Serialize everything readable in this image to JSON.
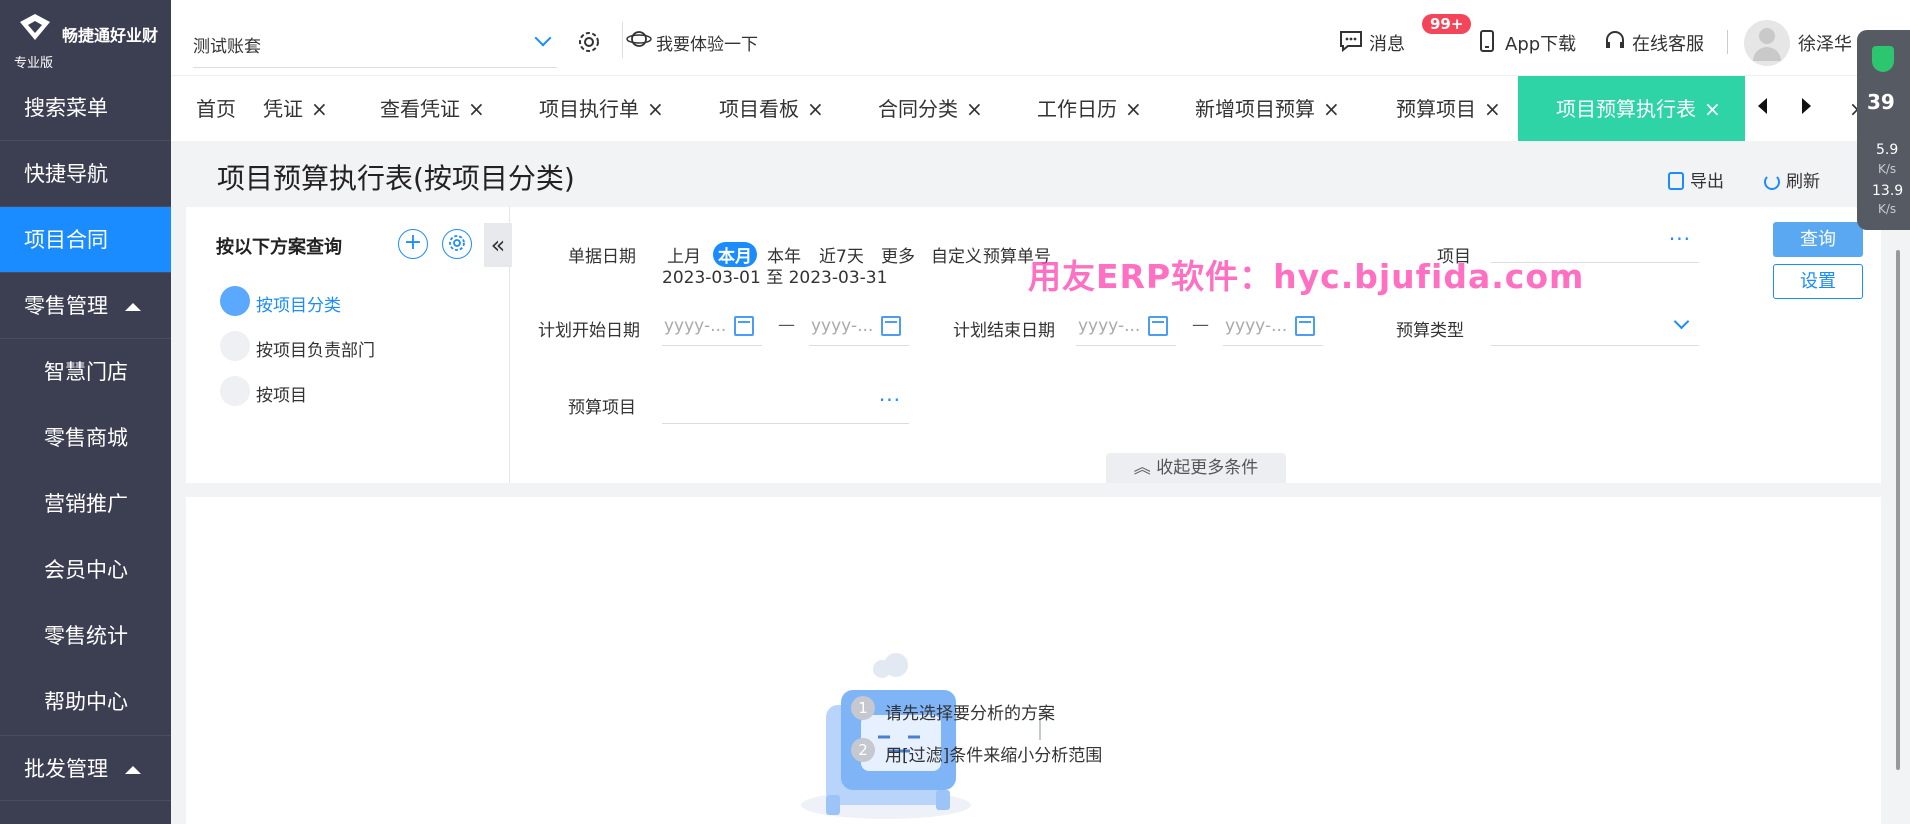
{
  "brand": {
    "name": "畅捷通好业财",
    "edition": "专业版"
  },
  "sidebar": {
    "items": [
      {
        "label": "搜索菜单"
      },
      {
        "label": "快捷导航"
      },
      {
        "label": "项目合同"
      },
      {
        "label": "零售管理"
      },
      {
        "label": "智慧门店"
      },
      {
        "label": "零售商城"
      },
      {
        "label": "营销推广"
      },
      {
        "label": "会员中心"
      },
      {
        "label": "零售统计"
      },
      {
        "label": "帮助中心"
      },
      {
        "label": "批发管理"
      }
    ]
  },
  "topbar": {
    "account": "测试账套",
    "try_label": "我要体验一下",
    "messages_label": "消息",
    "messages_badge": "99+",
    "app_download": "App下载",
    "online_service": "在线客服",
    "user_name": "徐泽华"
  },
  "tabs": [
    {
      "label": "首页"
    },
    {
      "label": "凭证"
    },
    {
      "label": "查看凭证"
    },
    {
      "label": "项目执行单"
    },
    {
      "label": "项目看板"
    },
    {
      "label": "合同分类"
    },
    {
      "label": "工作日历"
    },
    {
      "label": "新增项目预算"
    },
    {
      "label": "预算项目"
    },
    {
      "label": "项目预算执行表"
    }
  ],
  "tab_close": "×",
  "page": {
    "title": "项目预算执行表(按项目分类)",
    "export_label": "导出",
    "refresh_label": "刷新"
  },
  "scheme": {
    "title": "按以下方案查询",
    "items": [
      {
        "label": "按项目分类"
      },
      {
        "label": "按项目负责部门"
      },
      {
        "label": "按项目"
      }
    ]
  },
  "filter": {
    "doc_date_label": "单据日期",
    "quick": [
      "上月",
      "本月",
      "本年",
      "近7天",
      "更多",
      "自定义"
    ],
    "range_text": "2023-03-01 至 2023-03-31",
    "budget_no_label": "预算单号",
    "project_label": "项目",
    "plan_start_label": "计划开始日期",
    "plan_end_label": "计划结束日期",
    "date_placeholder": "yyyy-...",
    "dash": "—",
    "budget_type_label": "预算类型",
    "budget_item_label": "预算项目",
    "collapse_more": "收起更多条件",
    "query_button": "查询",
    "settings_button": "设置",
    "more_dots": "···"
  },
  "watermark": "用友ERP软件：hyc.bjufida.com",
  "empty_tips": [
    {
      "num": "1",
      "text": "请先选择要分析的方案"
    },
    {
      "num": "2",
      "text": "用[过滤]条件来缩小分析范围"
    }
  ],
  "speed_widget": {
    "percent": "39",
    "up": "5.9",
    "up_unit": "K/s",
    "down": "13.9",
    "down_unit": "K/s"
  },
  "colors": {
    "sidebar_bg": "#3c3f52",
    "accent": "#1a8cff",
    "active_tab": "#2ed3a6",
    "badge": "#f5455a"
  }
}
